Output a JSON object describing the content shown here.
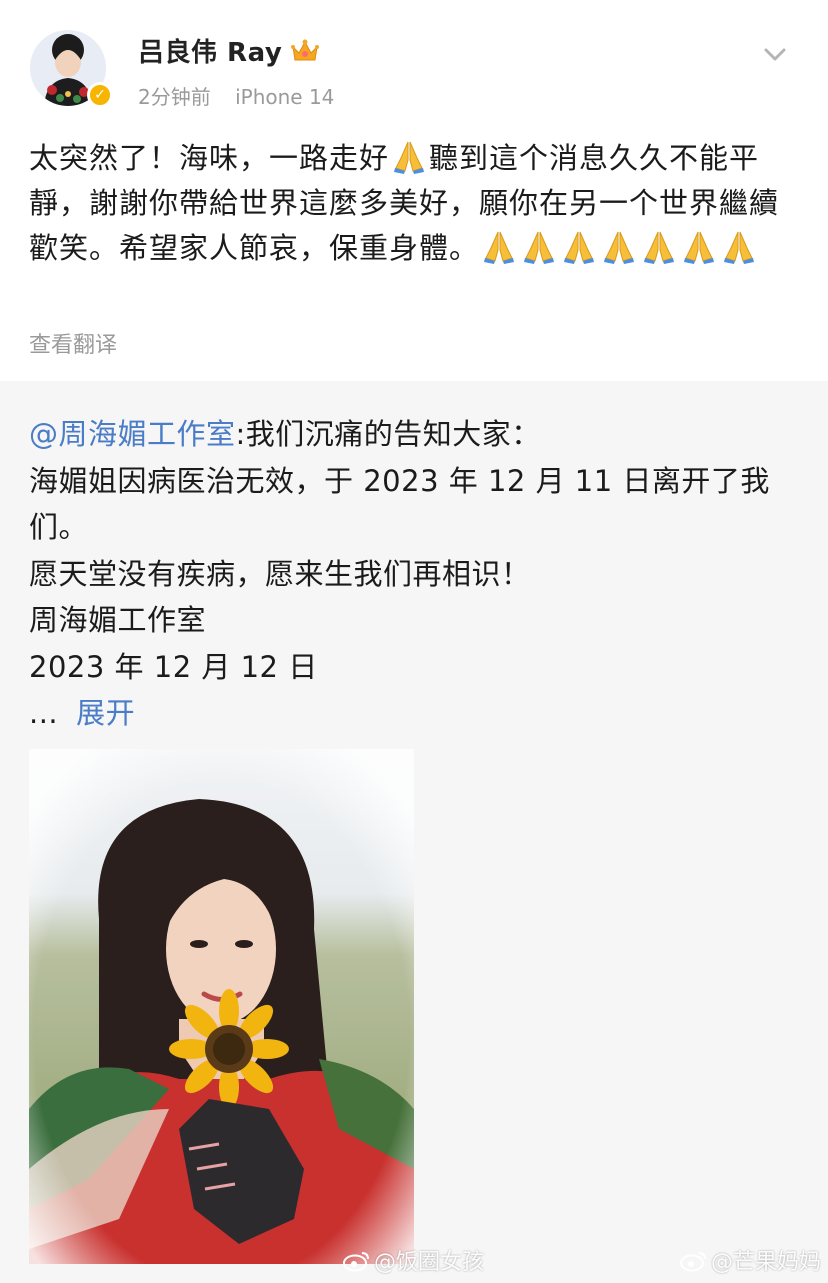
{
  "post": {
    "author": "吕良伟 Ray",
    "time": "2分钟前",
    "device": "iPhone 14",
    "text_segments": {
      "line_a": "太突然了！海味，一路走好",
      "line_b": "聽到這个消息久久不能平靜，謝謝你帶給世界這麼多美好，願你在另一个世界繼續歡笑。希望家人節哀，保重身體。"
    },
    "translate_label": "查看翻译"
  },
  "repost": {
    "mention": "@周海媚工作室",
    "lines": [
      ":我们沉痛的告知大家：",
      "海媚姐因病医治无效，于 2023 年 12 月 11 日离开了我们。",
      "愿天堂没有疾病，愿来生我们再相识！",
      "周海媚工作室",
      "2023 年 12 月 12 日"
    ],
    "ellipsis": "...",
    "expand_label": "展开"
  },
  "watermarks": [
    "@饭圈女孩",
    "@芒果妈妈"
  ],
  "icons": {
    "verified": "verified-badge-icon",
    "crown": "crown-icon",
    "more": "chevron-down-icon",
    "pray": "folded-hands-icon"
  },
  "colors": {
    "link": "#4a7cc7",
    "meta": "#9a9a9a",
    "repost_bg": "#f6f6f6",
    "verified": "#f7b500"
  }
}
